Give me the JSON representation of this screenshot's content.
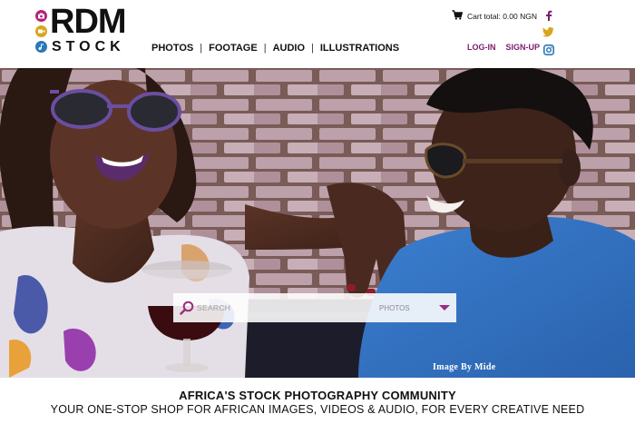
{
  "brand": {
    "name": "RDM",
    "sub": "STOCK",
    "dot_colors": [
      "#b3257a",
      "#d9a51f",
      "#2a79b8"
    ]
  },
  "nav": {
    "items": [
      "PHOTOS",
      "FOOTAGE",
      "AUDIO",
      "ILLUSTRATIONS"
    ],
    "separator": "|"
  },
  "cart": {
    "icon": "shopping-cart-icon",
    "label": "Cart total: 0.00 NGN"
  },
  "auth": {
    "login": "LOG-IN",
    "signup": "SIGN-UP"
  },
  "social": {
    "icons": [
      "facebook-icon",
      "twitter-icon",
      "instagram-icon"
    ],
    "facebook_color": "#7b1c6b",
    "twitter_color": "#d9a51f",
    "instagram_color": "#2a79b8"
  },
  "search": {
    "placeholder": "SEARCH",
    "category": "PHOTOS",
    "accent": "#9b2c82"
  },
  "hero": {
    "credit": "Image By Mide"
  },
  "tagline": {
    "title": "AFRICA'S STOCK PHOTOGRAPHY COMMUNITY",
    "subtitle": "YOUR ONE-STOP SHOP FOR AFRICAN IMAGES, VIDEOS & AUDIO, FOR EVERY CREATIVE NEED"
  }
}
